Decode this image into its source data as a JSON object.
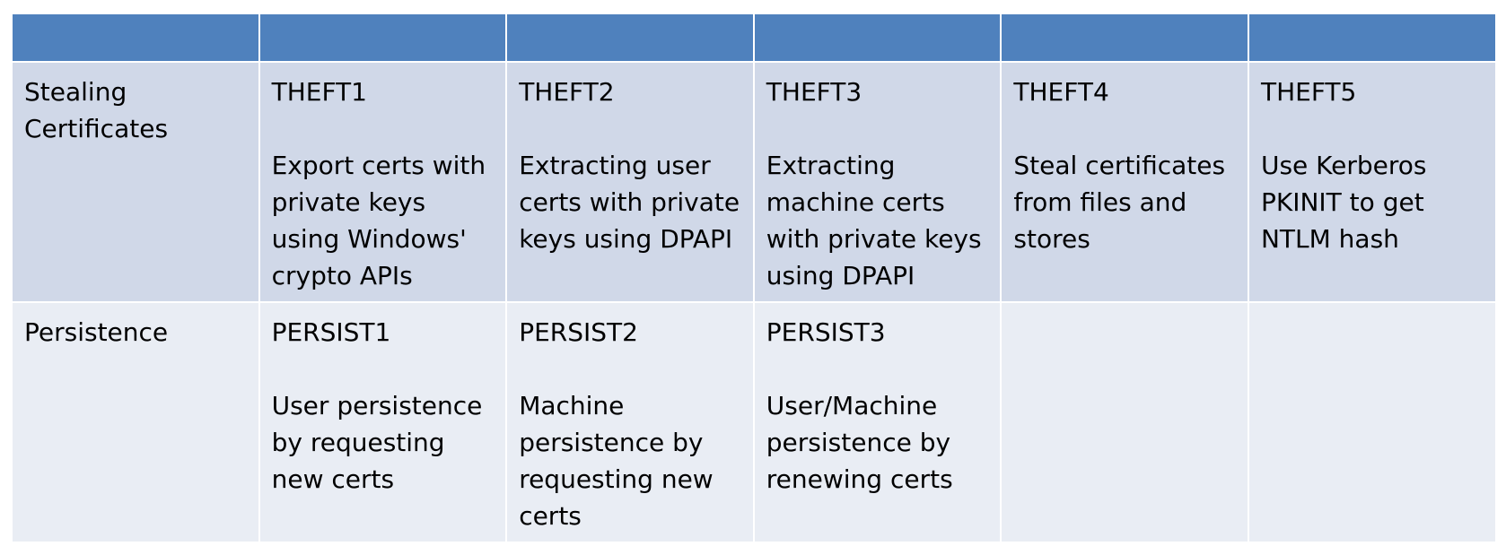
{
  "colors": {
    "header_bg": "#4F81BD",
    "row1_bg": "#D0D8E8",
    "row2_bg": "#E9EDF4",
    "text": "#000000",
    "border": "#FFFFFF"
  },
  "header": {
    "cells": [
      "",
      "",
      "",
      "",
      "",
      ""
    ]
  },
  "rows": [
    {
      "category": "Stealing Certificates",
      "cells": [
        {
          "code": "THEFT1",
          "desc": "Export certs with private keys using Windows' crypto APIs"
        },
        {
          "code": "THEFT2",
          "desc": "Extracting user certs with private keys using DPAPI"
        },
        {
          "code": "THEFT3",
          "desc": "Extracting machine certs with private keys using DPAPI"
        },
        {
          "code": "THEFT4",
          "desc": "Steal certificates from files and stores"
        },
        {
          "code": "THEFT5",
          "desc": "Use Kerberos PKINIT to get NTLM hash"
        }
      ]
    },
    {
      "category": "Persistence",
      "cells": [
        {
          "code": "PERSIST1",
          "desc": "User persistence by requesting new certs"
        },
        {
          "code": "PERSIST2",
          "desc": "Machine persistence by requesting new certs"
        },
        {
          "code": "PERSIST3",
          "desc": "User/Machine persistence by renewing certs"
        },
        {
          "code": "",
          "desc": ""
        },
        {
          "code": "",
          "desc": ""
        }
      ]
    }
  ]
}
